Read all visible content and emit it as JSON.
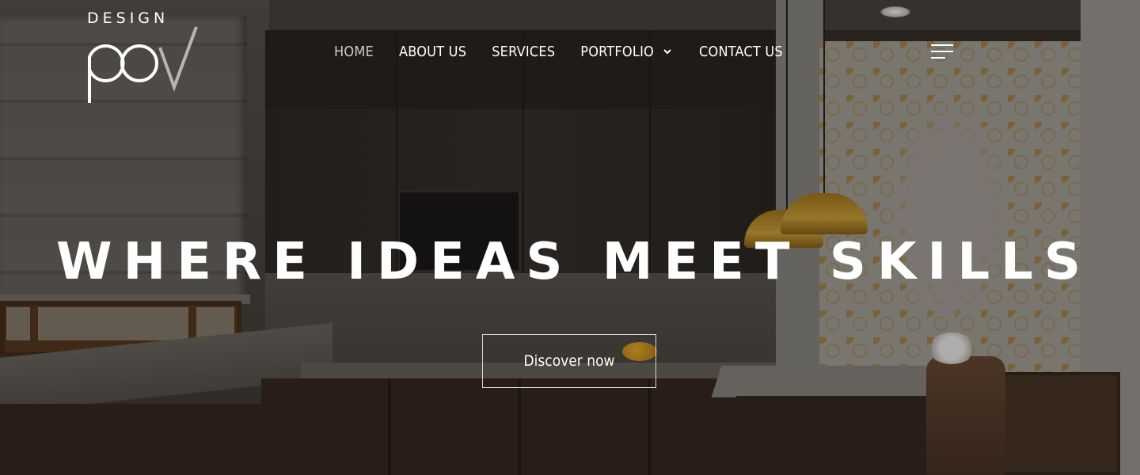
{
  "brand": {
    "logo_word": "DESIGN",
    "logo_mark_text": "POV"
  },
  "nav": {
    "items": [
      {
        "label": "HOME",
        "active": true
      },
      {
        "label": "ABOUT US",
        "active": false
      },
      {
        "label": "SERVICES",
        "active": false
      },
      {
        "label": "PORTFOLIO",
        "active": false,
        "has_dropdown": true,
        "icon": "chevron-down-icon"
      },
      {
        "label": "CONTACT US",
        "active": false
      }
    ],
    "menu_icon": "hamburger-menu-icon"
  },
  "hero": {
    "headline": "WHERE IDEAS MEET SKILLS",
    "cta_label": "Discover now",
    "background_image": "kitchen-interior"
  },
  "colors": {
    "text": "#ffffff",
    "active_nav": "#cfcac4",
    "cta_border": "#d9d4ce",
    "overlay": "rgba(0,0,0,0.28)"
  }
}
